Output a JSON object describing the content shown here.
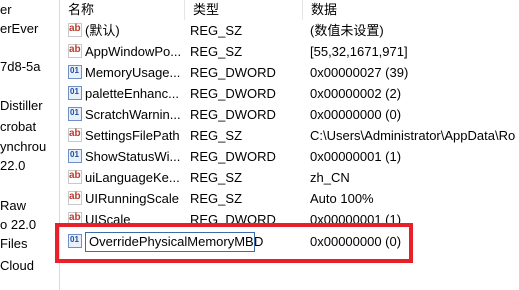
{
  "tree": {
    "items": [
      "er",
      "erEver",
      "7d8-5a",
      "Distiller",
      "crobat",
      "ynchrou",
      "22.0",
      "Raw",
      "o 22.0",
      "Files",
      "Cloud"
    ]
  },
  "columns": {
    "name": "名称",
    "type": "类型",
    "data": "数据"
  },
  "rows": [
    {
      "icon": "string-value-icon",
      "name": "(默认)",
      "type": "REG_SZ",
      "data": "(数值未设置)"
    },
    {
      "icon": "string-value-icon",
      "name": "AppWindowPo...",
      "type": "REG_SZ",
      "data": "[55,32,1671,971]"
    },
    {
      "icon": "dword-value-icon",
      "name": "MemoryUsage...",
      "type": "REG_DWORD",
      "data": "0x00000027 (39)"
    },
    {
      "icon": "dword-value-icon",
      "name": "paletteEnhanc...",
      "type": "REG_DWORD",
      "data": "0x00000002 (2)"
    },
    {
      "icon": "dword-value-icon",
      "name": "ScratchWarnin...",
      "type": "REG_DWORD",
      "data": "0x00000000 (0)"
    },
    {
      "icon": "string-value-icon",
      "name": "SettingsFilePath",
      "type": "REG_SZ",
      "data": "C:\\Users\\Administrator\\AppData\\Ro"
    },
    {
      "icon": "dword-value-icon",
      "name": "ShowStatusWi...",
      "type": "REG_DWORD",
      "data": "0x00000001 (1)"
    },
    {
      "icon": "string-value-icon",
      "name": "uiLanguageKe...",
      "type": "REG_SZ",
      "data": "zh_CN"
    },
    {
      "icon": "string-value-icon",
      "name": "UIRunningScale",
      "type": "REG_SZ",
      "data": "Auto 100%"
    },
    {
      "icon": "string-value-icon",
      "name": "UIScale",
      "type": "REG_DWORD",
      "data": "0x00000001 (1)"
    },
    {
      "icon": "dword-value-icon",
      "name": "",
      "type": "D",
      "data": "0x00000000 (0)"
    }
  ],
  "rename_field": {
    "value": "OverridePhysicalMemoryMB"
  },
  "colors": {
    "highlight": "#e8202a",
    "edit_border": "#3b6ea5"
  }
}
